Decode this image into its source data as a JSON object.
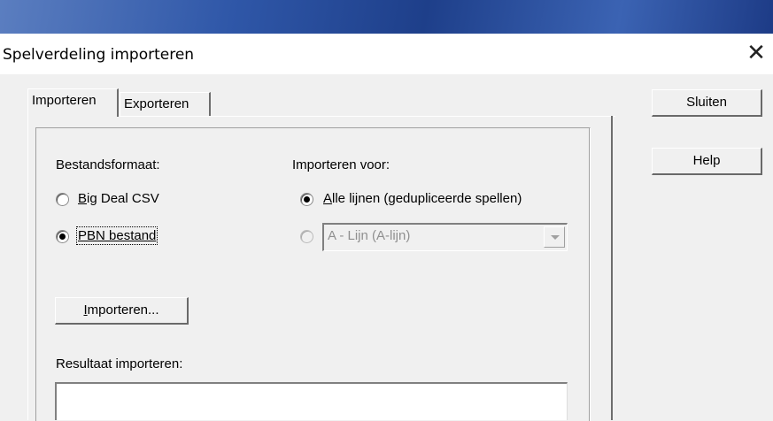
{
  "window": {
    "title": "Spelverdeling importeren",
    "close_symbol": "✕"
  },
  "tabs": [
    {
      "label": "Importeren",
      "active": true
    },
    {
      "label": "Exporteren",
      "active": false
    }
  ],
  "import_tab": {
    "file_format_label": "Bestandsformaat:",
    "file_format_options": [
      {
        "mnemonic": "B",
        "rest": "ig Deal CSV",
        "checked": false
      },
      {
        "label": "PBN bestand",
        "checked": true
      }
    ],
    "import_for_label": "Importeren voor:",
    "import_for_options": [
      {
        "mnemonic": "A",
        "rest": "lle lijnen (gedupliceerde spellen)",
        "checked": true
      },
      {
        "checked": false,
        "disabled": true
      }
    ],
    "line_select_value": "A - Lijn (A-lijn)",
    "import_button": {
      "mnemonic": "I",
      "rest": "mporteren..."
    },
    "result_label": "Resultaat importeren:",
    "result_text": ""
  },
  "side_buttons": {
    "close_label": "Sluiten",
    "help_label": "Help"
  }
}
